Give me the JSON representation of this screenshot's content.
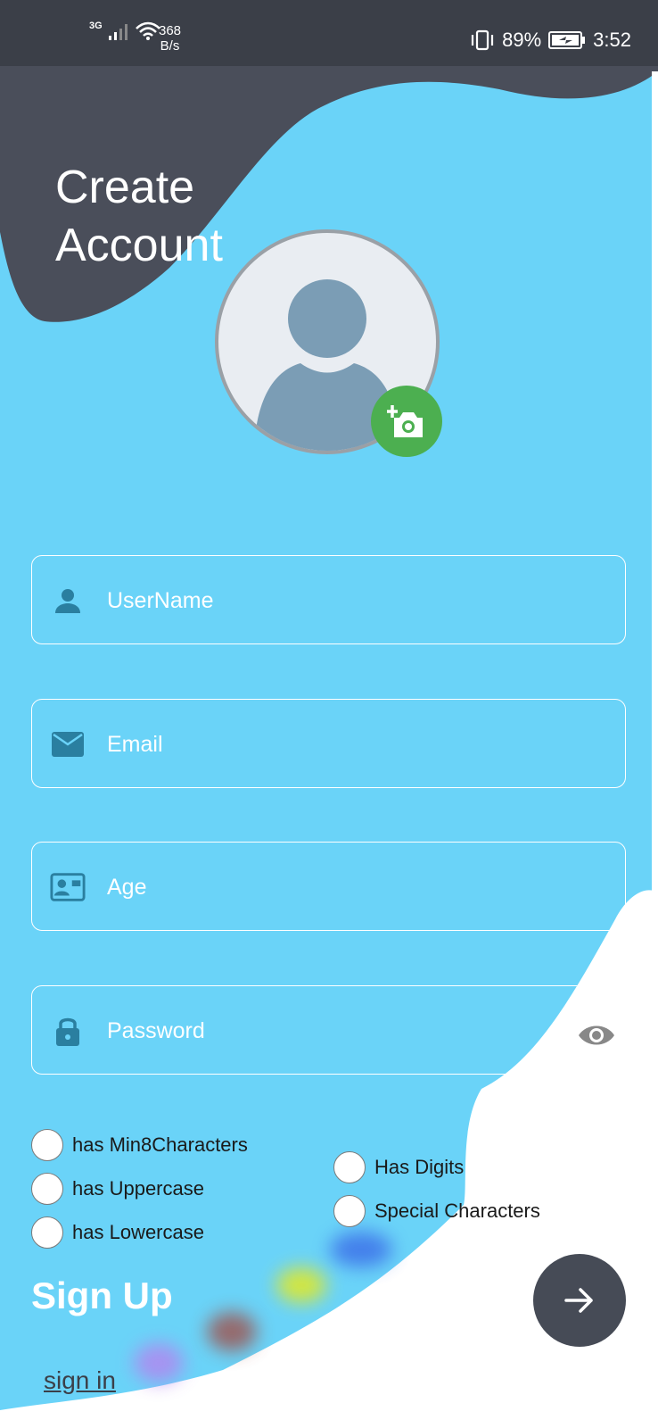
{
  "status_bar": {
    "network_type": "3G",
    "speed_value": "368",
    "speed_unit": "B/s",
    "battery_percent": "89%",
    "time": "3:52"
  },
  "header": {
    "title_line1": "Create",
    "title_line2": "Account"
  },
  "avatar": {
    "icon": "person-icon",
    "add_photo_icon": "add-a-photo-icon"
  },
  "form": {
    "username": {
      "placeholder": "UserName",
      "icon": "person-icon"
    },
    "email": {
      "placeholder": "Email",
      "icon": "mail-icon"
    },
    "age": {
      "placeholder": "Age",
      "icon": "contact-card-icon"
    },
    "password": {
      "placeholder": "Password",
      "icon": "lock-icon",
      "toggle_icon": "eye-icon"
    }
  },
  "password_rules": {
    "min8": "has Min8Characters",
    "uppercase": "has Uppercase",
    "lowercase": "has Lowercase",
    "digits": "Has Digits",
    "special": "Special Characters"
  },
  "footer": {
    "signup_label": "Sign Up",
    "signin_link": "sign in",
    "next_icon": "arrow-right-icon"
  },
  "colors": {
    "background": "#6ad3f8",
    "dark": "#3b3f48",
    "accent_green": "#4caf50"
  }
}
